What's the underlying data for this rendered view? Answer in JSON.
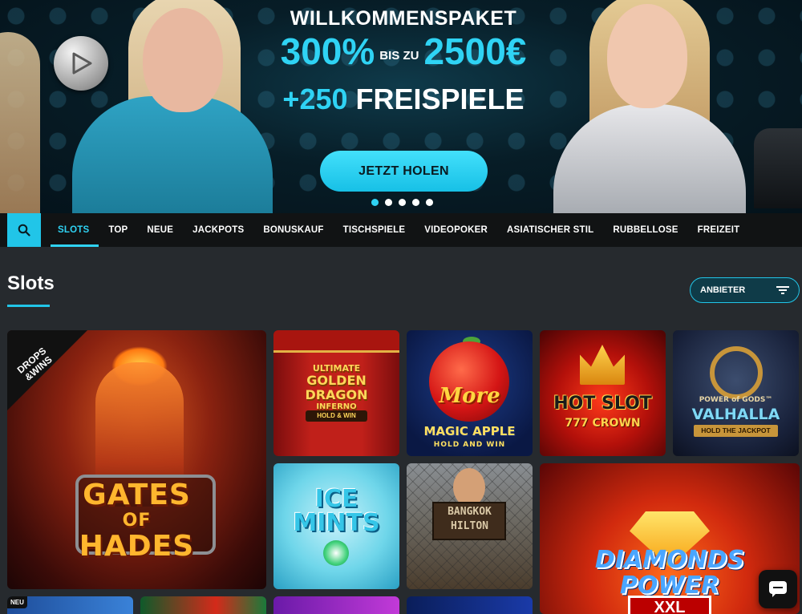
{
  "hero": {
    "line1": "WILLKOMMENSPAKET",
    "percent": "300%",
    "bis_zu": "BIS ZU",
    "amount": "2500€",
    "spins_number": "+250",
    "spins_label": "FREISPIELE",
    "cta_label": "JETZT HOLEN",
    "slide_count": 5,
    "active_slide": 1
  },
  "nav": {
    "items": [
      {
        "label": "SLOTS",
        "active": true
      },
      {
        "label": "TOP"
      },
      {
        "label": "NEUE"
      },
      {
        "label": "JACKPOTS"
      },
      {
        "label": "BONUSKAUF"
      },
      {
        "label": "TISCHSPIELE"
      },
      {
        "label": "VIDEOPOKER"
      },
      {
        "label": "ASIATISCHER STIL"
      },
      {
        "label": "RUBBELLOSE"
      },
      {
        "label": "FREIZEIT"
      }
    ]
  },
  "section": {
    "title": "Slots",
    "filter_label": "ANBIETER"
  },
  "games": {
    "hades": {
      "title_line1": "GATES",
      "title_line2": "OF",
      "title_line3": "HADES",
      "ribbon_line1": "DROPS",
      "ribbon_line2": "&WINS"
    },
    "golden": {
      "line1": "ULTIMATE",
      "line2": "GOLDEN",
      "line3": "DRAGON",
      "line4": "INFERNO",
      "sub": "HOLD & WIN"
    },
    "apple": {
      "title": "More",
      "sub": "MAGIC APPLE",
      "sub2": "HOLD AND WIN"
    },
    "hot": {
      "title": "HOT SLOT",
      "sub": "777 CROWN"
    },
    "valhalla": {
      "pre": "POWER of GODS™",
      "title": "VALHALLA",
      "sub": "HOLD THE JACKPOT"
    },
    "ice": {
      "line1": "ICE",
      "line2": "MINTS"
    },
    "bangkok": {
      "line1": "BANGKOK",
      "line2": "HILTON"
    },
    "diamonds": {
      "title_line1": "DIAMONDS",
      "title_line2": "POWER",
      "xxl": "XXL"
    },
    "bottom1_badge": "NEU"
  },
  "colors": {
    "accent": "#21c5e8",
    "background": "#262a2e",
    "nav_background": "#111314"
  },
  "icons": {
    "search": "search-icon",
    "filter": "filter-icon",
    "chat": "chat-icon"
  }
}
